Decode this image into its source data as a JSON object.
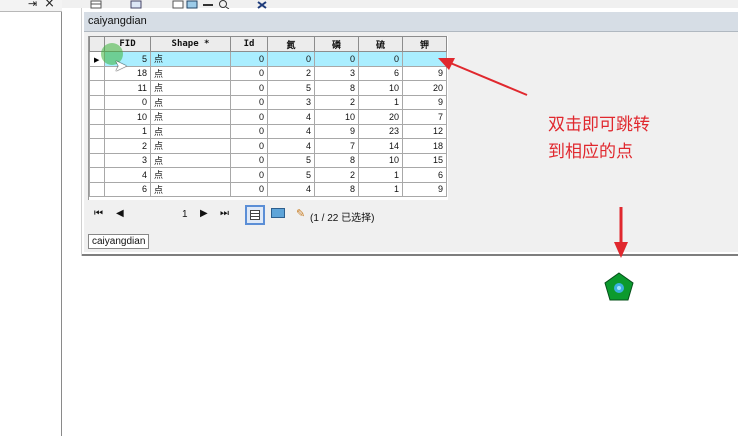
{
  "window": {
    "title": "caiyangdian"
  },
  "table": {
    "columns": [
      "FID",
      "Shape *",
      "Id",
      "氮",
      "磷",
      "硫",
      "钾"
    ],
    "rows": [
      [
        "5",
        "点",
        "0",
        "0",
        "0",
        "0",
        ""
      ],
      [
        "18",
        "点",
        "0",
        "2",
        "3",
        "6",
        "9"
      ],
      [
        "11",
        "点",
        "0",
        "5",
        "8",
        "10",
        "20"
      ],
      [
        "0",
        "点",
        "0",
        "3",
        "2",
        "1",
        "9"
      ],
      [
        "10",
        "点",
        "0",
        "4",
        "10",
        "20",
        "7"
      ],
      [
        "1",
        "点",
        "0",
        "4",
        "9",
        "23",
        "12"
      ],
      [
        "2",
        "点",
        "0",
        "4",
        "7",
        "14",
        "18"
      ],
      [
        "3",
        "点",
        "0",
        "5",
        "8",
        "10",
        "15"
      ],
      [
        "4",
        "点",
        "0",
        "5",
        "2",
        "1",
        "6"
      ],
      [
        "6",
        "点",
        "0",
        "4",
        "8",
        "1",
        "9"
      ]
    ],
    "active_row": 0
  },
  "nav": {
    "first": "⏮",
    "prev": "◀",
    "page": "1",
    "next": "▶",
    "last": "⏭",
    "selection_count": "(1 / 22 已选择)"
  },
  "bottom_tab": {
    "label": "caiyangdian"
  },
  "annotation": {
    "line1": "双击即可跳转",
    "line2": "到相应的点"
  },
  "icons": {
    "pin": "pin-icon",
    "close": "close-icon",
    "row_pointer": "row-pointer-icon",
    "table_view": "table-view-icon",
    "map_view": "map-view-icon",
    "pencil": "pencil-icon",
    "point_symbol": "pentagon-point-icon",
    "cursor": "cursor-icon"
  },
  "colors": {
    "annotation_red": "#e0282e",
    "selected_row": "#aaeeff",
    "point_fill": "#0c9a2e",
    "point_center": "#3ab0e0"
  }
}
